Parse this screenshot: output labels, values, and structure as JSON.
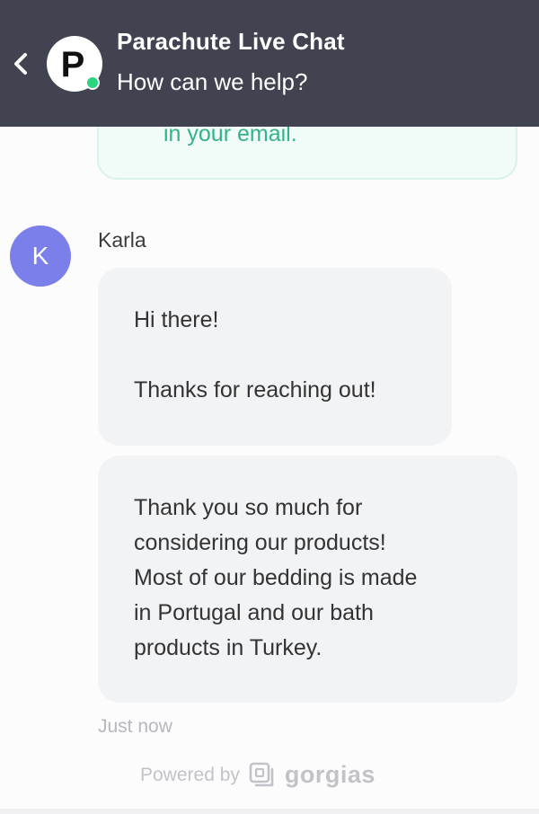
{
  "header": {
    "title": "Parachute Live Chat",
    "subtitle": "How can we help?",
    "logo_letter": "P",
    "back_icon": "chevron-left-icon",
    "status": "online",
    "status_color": "#2bd47e",
    "background": "#414350"
  },
  "previous_message": {
    "visible_text": "in your email."
  },
  "agent": {
    "name": "Karla",
    "avatar_initial": "K",
    "avatar_color": "#7a7fea"
  },
  "messages": [
    {
      "lines": [
        "Hi there!",
        "Thanks for reaching out!"
      ]
    },
    {
      "lines": [
        "Thank you so much for",
        "considering our products!",
        "Most of our bedding is made",
        "in Portugal and our bath",
        "products in Turkey."
      ]
    }
  ],
  "timestamp": "Just now",
  "footer": {
    "powered_by_label": "Powered by",
    "brand_name": "gorgias",
    "brand_icon": "gorgias-logo-icon"
  }
}
